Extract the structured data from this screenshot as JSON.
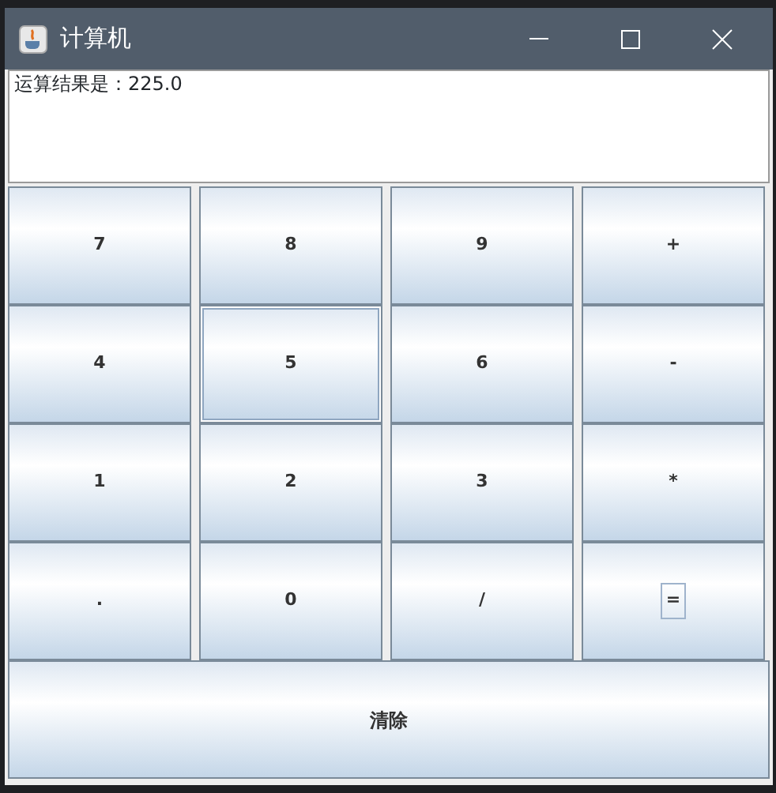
{
  "window": {
    "title": "计算机"
  },
  "display": {
    "text": "运算结果是：225.0"
  },
  "keys": [
    {
      "label": "7",
      "highlighted": false,
      "focused": false
    },
    {
      "label": "8",
      "highlighted": false,
      "focused": false
    },
    {
      "label": "9",
      "highlighted": false,
      "focused": false
    },
    {
      "label": "+",
      "highlighted": false,
      "focused": false
    },
    {
      "label": "4",
      "highlighted": false,
      "focused": false
    },
    {
      "label": "5",
      "highlighted": true,
      "focused": false
    },
    {
      "label": "6",
      "highlighted": false,
      "focused": false
    },
    {
      "label": "-",
      "highlighted": false,
      "focused": false
    },
    {
      "label": "1",
      "highlighted": false,
      "focused": false
    },
    {
      "label": "2",
      "highlighted": false,
      "focused": false
    },
    {
      "label": "3",
      "highlighted": false,
      "focused": false
    },
    {
      "label": "*",
      "highlighted": false,
      "focused": false
    },
    {
      "label": ".",
      "highlighted": false,
      "focused": false
    },
    {
      "label": "0",
      "highlighted": false,
      "focused": false
    },
    {
      "label": "/",
      "highlighted": false,
      "focused": false
    },
    {
      "label": "=",
      "highlighted": false,
      "focused": true
    }
  ],
  "clear_button": {
    "label": "清除"
  }
}
